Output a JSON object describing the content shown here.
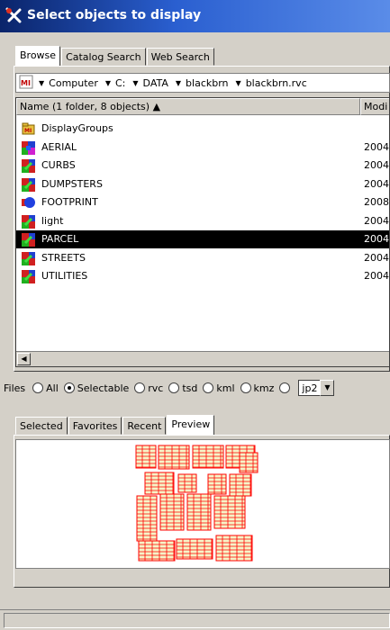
{
  "window": {
    "title": "Select objects to display"
  },
  "browse_tabs": [
    {
      "label": "Browse",
      "active": true
    },
    {
      "label": "Catalog Search",
      "active": false
    },
    {
      "label": "Web Search",
      "active": false
    }
  ],
  "path": {
    "icon": "mi-file-icon",
    "crumbs": [
      "Computer",
      "C:",
      "DATA",
      "blackbrn",
      "blackbrn.rvc"
    ]
  },
  "list": {
    "columns": [
      "Name (1 folder, 8 objects) ▲",
      "Modi"
    ],
    "rows": [
      {
        "name": "DisplayGroups",
        "date": "",
        "icon": "folder-icon",
        "selected": false
      },
      {
        "name": "AERIAL",
        "date": "2004",
        "icon": "raster-object-icon",
        "selected": false
      },
      {
        "name": "CURBS",
        "date": "2004",
        "icon": "vector-object-icon",
        "selected": false
      },
      {
        "name": "DUMPSTERS",
        "date": "2004",
        "icon": "vector-object-icon",
        "selected": false
      },
      {
        "name": "FOOTPRINT",
        "date": "2008",
        "icon": "shape-object-icon",
        "selected": false
      },
      {
        "name": "light",
        "date": "2004",
        "icon": "vector-object-icon",
        "selected": false
      },
      {
        "name": "PARCEL",
        "date": "2004",
        "icon": "vector-object-icon",
        "selected": true
      },
      {
        "name": "STREETS",
        "date": "2004",
        "icon": "vector-object-icon",
        "selected": false
      },
      {
        "name": "UTILITIES",
        "date": "2004",
        "icon": "vector-object-icon",
        "selected": false
      }
    ]
  },
  "filter": {
    "label": "Files",
    "options": [
      {
        "label": "All",
        "checked": false
      },
      {
        "label": "Selectable",
        "checked": true
      },
      {
        "label": "rvc",
        "checked": false
      },
      {
        "label": "tsd",
        "checked": false
      },
      {
        "label": "kml",
        "checked": false
      },
      {
        "label": "kmz",
        "checked": false
      },
      {
        "label": "",
        "checked": false
      }
    ],
    "combo_value": "jp2"
  },
  "bottom_tabs": [
    {
      "label": "Selected",
      "active": false
    },
    {
      "label": "Favorites",
      "active": false
    },
    {
      "label": "Recent",
      "active": false
    },
    {
      "label": "Preview",
      "active": true
    }
  ],
  "colors": {
    "parcel_outline": "#ff0000",
    "parcel_fill": "#f5f5c8",
    "selection": "#000000"
  }
}
